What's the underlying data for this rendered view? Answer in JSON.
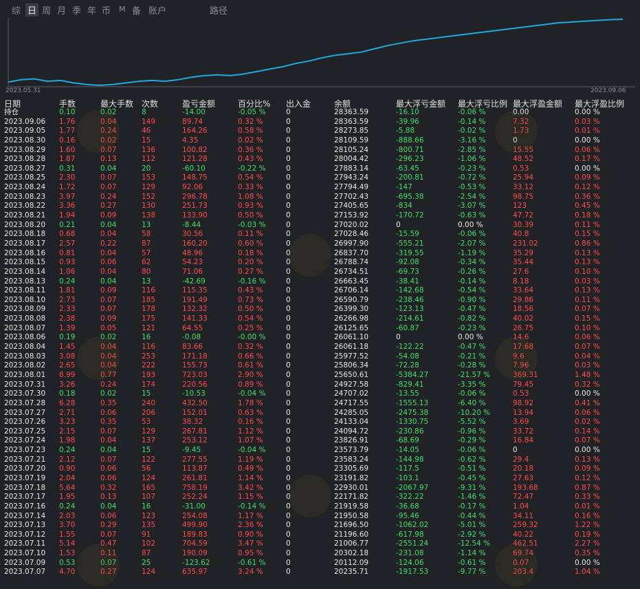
{
  "tabs": [
    {
      "label": "综",
      "active": false
    },
    {
      "label": "日",
      "active": true
    },
    {
      "label": "周",
      "active": false
    },
    {
      "label": "月",
      "active": false
    },
    {
      "label": "季",
      "active": false
    },
    {
      "label": "年",
      "active": false
    },
    {
      "label": "币",
      "active": false
    },
    {
      "label": "M",
      "active": false
    },
    {
      "label": "备",
      "active": false
    },
    {
      "label": "账户",
      "active": false
    },
    {
      "label": "路径",
      "active": false
    }
  ],
  "chart_data": {
    "type": "line",
    "x_start": "2023.05.31",
    "x_end": "2023.09.06",
    "line_color": "#1fa9e0",
    "values": [
      20.6,
      20.9,
      21.0,
      20.7,
      20.8,
      20.5,
      20.3,
      20.2,
      20.3,
      20.5,
      20.7,
      20.8,
      20.7,
      20.9,
      21.2,
      21.4,
      21.5,
      21.4,
      21.6,
      21.9,
      22.2,
      22.5,
      22.9,
      23.2,
      23.6,
      23.9,
      24.1,
      24.3,
      24.7,
      25.1,
      25.4,
      25.7,
      25.9,
      26.1,
      26.3,
      26.5,
      26.7,
      26.9,
      27.1,
      27.3,
      27.5,
      27.7,
      27.9,
      28.0,
      28.1,
      28.2,
      28.3,
      28.35
    ]
  },
  "headers": [
    "日期",
    "手数",
    "最大手数",
    "次数",
    "盈亏金额",
    "百分比%",
    "出入金",
    "余额",
    "最大浮亏金额",
    "最大浮亏比例",
    "最大浮盈金额",
    "最大浮盈比例"
  ],
  "rows": [
    [
      "持仓",
      "0.10",
      "0.02",
      "8",
      "-14.00",
      "-0.05 %",
      "0",
      "28363.59",
      "-16.10",
      "-0.06 %",
      "0.00",
      "0.00 %"
    ],
    [
      "2023.09.06",
      "1.76",
      "0.04",
      "149",
      "89.74",
      "0.32 %",
      "0",
      "28363.59",
      "-39.96",
      "-0.14 %",
      "7.32",
      "0.03 %"
    ],
    [
      "2023.09.05",
      "1.77",
      "0.24",
      "46",
      "164.26",
      "0.58 %",
      "0",
      "28273.85",
      "-5.88",
      "-0.02 %",
      "1.73",
      "0.01 %"
    ],
    [
      "2023.08.30",
      "0.16",
      "0.02",
      "15",
      "4.35",
      "0.02 %",
      "0",
      "28109.59",
      "-888.66",
      "-3.16 %",
      "0",
      "0.00 %"
    ],
    [
      "2023.08.29",
      "1.60",
      "0.07",
      "136",
      "100.82",
      "0.36 %",
      "0",
      "28105.24",
      "-800.71",
      "-2.85 %",
      "15.55",
      "0.06 %"
    ],
    [
      "2023.08.28",
      "1.87",
      "0.13",
      "112",
      "121.28",
      "0.43 %",
      "0",
      "28004.42",
      "-296.23",
      "-1.06 %",
      "48.52",
      "0.17 %"
    ],
    [
      "2023.08.27",
      "0.31",
      "0.04",
      "20",
      "-60.10",
      "-0.22 %",
      "0",
      "27883.14",
      "-63.45",
      "-0.23 %",
      "0.53",
      "0.00 %"
    ],
    [
      "2023.08.25",
      "2.30",
      "0.07",
      "153",
      "148.75",
      "0.54 %",
      "0",
      "27943.24",
      "-200.81",
      "-0.72 %",
      "25.94",
      "0.09 %"
    ],
    [
      "2023.08.24",
      "1.72",
      "0.07",
      "129",
      "92.06",
      "0.33 %",
      "0",
      "27794.49",
      "-147",
      "-0.53 %",
      "33.12",
      "0.12 %"
    ],
    [
      "2023.08.23",
      "3.97",
      "0.24",
      "152",
      "296.78",
      "1.08 %",
      "0",
      "27702.43",
      "-695.38",
      "-2.54 %",
      "98.75",
      "0.36 %"
    ],
    [
      "2023.08.22",
      "3.36",
      "0.27",
      "130",
      "251.73",
      "0.93 %",
      "0",
      "27405.65",
      "-834",
      "-3.07 %",
      "123",
      "0.45 %"
    ],
    [
      "2023.08.21",
      "1.94",
      "0.09",
      "138",
      "133.90",
      "0.50 %",
      "0",
      "27153.92",
      "-170.72",
      "-0.63 %",
      "47.72",
      "0.18 %"
    ],
    [
      "2023.08.20",
      "0.21",
      "0.04",
      "13",
      "-8.44",
      "-0.03 %",
      "0",
      "27020.02",
      "0",
      "0.00 %",
      "30.39",
      "0.11 %"
    ],
    [
      "2023.08.18",
      "0.68",
      "0.04",
      "58",
      "30.56",
      "0.11 %",
      "0",
      "27028.46",
      "-15.59",
      "-0.06 %",
      "40.8",
      "0.15 %"
    ],
    [
      "2023.08.17",
      "2.57",
      "0.22",
      "87",
      "160.20",
      "0.60 %",
      "0",
      "26997.90",
      "-555.21",
      "-2.07 %",
      "231.02",
      "0.86 %"
    ],
    [
      "2023.08.16",
      "0.81",
      "0.04",
      "57",
      "48.96",
      "0.18 %",
      "0",
      "26837.70",
      "-319.55",
      "-1.19 %",
      "35.29",
      "0.13 %"
    ],
    [
      "2023.08.15",
      "0.93",
      "0.06",
      "62",
      "54.23",
      "0.20 %",
      "0",
      "26788.74",
      "-92.08",
      "-0.34 %",
      "35.44",
      "0.13 %"
    ],
    [
      "2023.08.14",
      "1.06",
      "0.04",
      "80",
      "71.06",
      "0.27 %",
      "0",
      "26734.51",
      "-69.73",
      "-0.26 %",
      "27.6",
      "0.10 %"
    ],
    [
      "2023.08.13",
      "0.24",
      "0.04",
      "13",
      "-42.69",
      "-0.16 %",
      "0",
      "26663.45",
      "-38.41",
      "-0.14 %",
      "8.18",
      "0.03 %"
    ],
    [
      "2023.08.11",
      "1.81",
      "0.09",
      "116",
      "115.35",
      "0.43 %",
      "0",
      "26706.14",
      "-142.68",
      "-0.54 %",
      "33.64",
      "0.13 %"
    ],
    [
      "2023.08.10",
      "2.73",
      "0.07",
      "185",
      "191.49",
      "0.73 %",
      "0",
      "26590.79",
      "-238.46",
      "-0.90 %",
      "29.86",
      "0.11 %"
    ],
    [
      "2023.08.09",
      "2.33",
      "0.07",
      "178",
      "132.32",
      "0.50 %",
      "0",
      "26399.30",
      "-123.13",
      "-0.47 %",
      "18.56",
      "0.07 %"
    ],
    [
      "2023.08.08",
      "2.38",
      "0.09",
      "175",
      "141.33",
      "0.54 %",
      "0",
      "26266.98",
      "-214.61",
      "-0.82 %",
      "40.02",
      "0.15 %"
    ],
    [
      "2023.08.07",
      "1.39",
      "0.05",
      "121",
      "64.55",
      "0.25 %",
      "0",
      "26125.65",
      "-60.87",
      "-0.23 %",
      "26.75",
      "0.10 %"
    ],
    [
      "2023.08.06",
      "0.19",
      "0.02",
      "16",
      "-0.08",
      "-0.00 %",
      "0",
      "26061.10",
      "0",
      "0.00 %",
      "14.6",
      "0.06 %"
    ],
    [
      "2023.08.04",
      "1.45",
      "0.04",
      "116",
      "83.66",
      "0.32 %",
      "0",
      "26061.18",
      "-122.22",
      "-0.47 %",
      "17.68",
      "0.07 %"
    ],
    [
      "2023.08.03",
      "3.08",
      "0.04",
      "253",
      "171.18",
      "0.66 %",
      "0",
      "25977.52",
      "-54.08",
      "-0.21 %",
      "9.6",
      "0.04 %"
    ],
    [
      "2023.08.02",
      "2.65",
      "0.04",
      "222",
      "155.73",
      "0.61 %",
      "0",
      "25806.34",
      "-72.28",
      "-0.28 %",
      "7.96",
      "0.03 %"
    ],
    [
      "2023.08.01",
      "8.99",
      "0.77",
      "193",
      "723.03",
      "2.90 %",
      "0",
      "25650.61",
      "-5384.27",
      "-21.57 %",
      "369.31",
      "1.48 %"
    ],
    [
      "2023.07.31",
      "3.26",
      "0.24",
      "174",
      "220.56",
      "0.89 %",
      "0",
      "24927.58",
      "-829.41",
      "-3.35 %",
      "79.45",
      "0.32 %"
    ],
    [
      "2023.07.30",
      "0.18",
      "0.02",
      "15",
      "-10.53",
      "-0.04 %",
      "0",
      "24707.02",
      "-13.55",
      "-0.06 %",
      "0.53",
      "0.00 %"
    ],
    [
      "2023.07.28",
      "6.28",
      "0.35",
      "240",
      "432.50",
      "1.78 %",
      "0",
      "24717.55",
      "-1555.13",
      "-6.40 %",
      "98.92",
      "0.41 %"
    ],
    [
      "2023.07.27",
      "2.71",
      "0.06",
      "206",
      "152.01",
      "0.63 %",
      "0",
      "24285.05",
      "-2475.38",
      "-10.20 %",
      "13.94",
      "0.06 %"
    ],
    [
      "2023.07.26",
      "3.23",
      "0.35",
      "53",
      "38.32",
      "0.16 %",
      "0",
      "24133.04",
      "-1330.75",
      "-5.52 %",
      "3.69",
      "0.02 %"
    ],
    [
      "2023.07.25",
      "2.15",
      "0.07",
      "129",
      "267.81",
      "1.12 %",
      "0",
      "24094.72",
      "-230.86",
      "-0.96 %",
      "33.72",
      "0.14 %"
    ],
    [
      "2023.07.24",
      "1.98",
      "0.04",
      "137",
      "253.12",
      "1.07 %",
      "0",
      "23826.91",
      "-68.69",
      "-0.29 %",
      "16.84",
      "0.07 %"
    ],
    [
      "2023.07.23",
      "0.24",
      "0.04",
      "15",
      "-9.45",
      "-0.04 %",
      "0",
      "23573.79",
      "-14.05",
      "-0.06 %",
      "0",
      "0.00 %"
    ],
    [
      "2023.07.21",
      "2.12",
      "0.07",
      "122",
      "277.55",
      "1.19 %",
      "0",
      "23583.24",
      "-144.98",
      "-0.62 %",
      "29.4",
      "0.13 %"
    ],
    [
      "2023.07.20",
      "0.90",
      "0.06",
      "56",
      "113.87",
      "0.49 %",
      "0",
      "23305.69",
      "-117.5",
      "-0.51 %",
      "20.18",
      "0.09 %"
    ],
    [
      "2023.07.19",
      "2.04",
      "0.06",
      "124",
      "261.81",
      "1.14 %",
      "0",
      "23191.82",
      "-103.1",
      "-0.45 %",
      "27.63",
      "0.12 %"
    ],
    [
      "2023.07.18",
      "5.64",
      "0.32",
      "165",
      "758.19",
      "3.42 %",
      "0",
      "22930.01",
      "-2067.97",
      "-9.31 %",
      "193.68",
      "0.87 %"
    ],
    [
      "2023.07.17",
      "1.95",
      "0.13",
      "107",
      "252.24",
      "1.15 %",
      "0",
      "22171.82",
      "-322.22",
      "-1.46 %",
      "72.47",
      "0.33 %"
    ],
    [
      "2023.07.16",
      "0.24",
      "0.04",
      "16",
      "-31.00",
      "-0.14 %",
      "0",
      "21919.58",
      "-36.68",
      "-0.17 %",
      "1.04",
      "0.01 %"
    ],
    [
      "2023.07.14",
      "2.03",
      "0.06",
      "123",
      "254.08",
      "1.17 %",
      "0",
      "21950.58",
      "-95.46",
      "-0.44 %",
      "34.11",
      "0.16 %"
    ],
    [
      "2023.07.13",
      "3.70",
      "0.29",
      "135",
      "499.90",
      "2.36 %",
      "0",
      "21696.50",
      "-1062.02",
      "-5.01 %",
      "259.32",
      "1.22 %"
    ],
    [
      "2023.07.12",
      "1.55",
      "0.07",
      "91",
      "189.83",
      "0.90 %",
      "0",
      "21196.60",
      "-617.98",
      "-2.92 %",
      "40.22",
      "0.19 %"
    ],
    [
      "2023.07.11",
      "5.14",
      "0.47",
      "102",
      "704.59",
      "3.47 %",
      "0",
      "21006.77",
      "-2551.24",
      "-12.54 %",
      "462.51",
      "2.27 %"
    ],
    [
      "2023.07.10",
      "1.53",
      "0.11",
      "87",
      "190.09",
      "0.95 %",
      "0",
      "20302.18",
      "-231.08",
      "-1.14 %",
      "69.74",
      "0.35 %"
    ],
    [
      "2023.07.09",
      "0.53",
      "0.07",
      "25",
      "-123.62",
      "-0.61 %",
      "0",
      "20112.09",
      "-124.06",
      "-0.61 %",
      "0.07",
      "0.00 %"
    ],
    [
      "2023.07.07",
      "4.70",
      "0.27",
      "124",
      "635.97",
      "3.24 %",
      "0",
      "20235.71",
      "-1917.53",
      "-9.77 %",
      "203.4",
      "1.04 %"
    ]
  ],
  "colors": {
    "positive": "#ff4b4b",
    "negative": "#3ee068",
    "neutral": "#e8e8e8",
    "background": "#202226"
  }
}
